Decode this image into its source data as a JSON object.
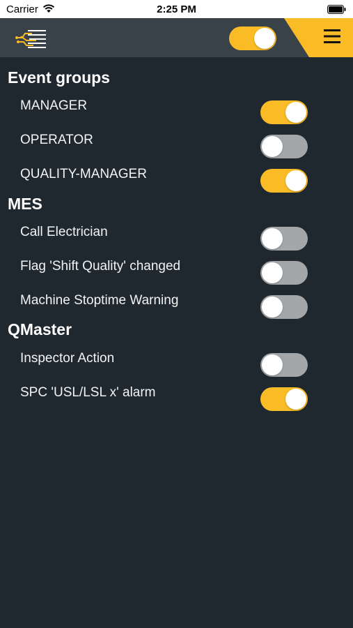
{
  "status_bar": {
    "carrier": "Carrier",
    "time": "2:25 PM",
    "icons": [
      "wifi-icon",
      "battery-icon"
    ]
  },
  "header": {
    "logo_icon": "circuit-logo-icon",
    "master_toggle_on": true,
    "menu_icon": "hamburger-menu-icon"
  },
  "colors": {
    "background": "#1f282f",
    "header": "#3a4249",
    "accent": "#f9bb26",
    "toggle_off": "#a3a7aa"
  },
  "groups": [
    {
      "title": "Event groups",
      "items": [
        {
          "label": "MANAGER",
          "on": true
        },
        {
          "label": "OPERATOR",
          "on": false
        },
        {
          "label": "QUALITY-MANAGER",
          "on": true
        }
      ]
    },
    {
      "title": "MES",
      "items": [
        {
          "label": "Call Electrician",
          "on": false
        },
        {
          "label": "Flag 'Shift Quality' changed",
          "on": false
        },
        {
          "label": "Machine Stoptime Warning",
          "on": false
        }
      ]
    },
    {
      "title": "QMaster",
      "items": [
        {
          "label": "Inspector Action",
          "on": false
        },
        {
          "label": "SPC 'USL/LSL x' alarm",
          "on": true
        }
      ]
    }
  ]
}
